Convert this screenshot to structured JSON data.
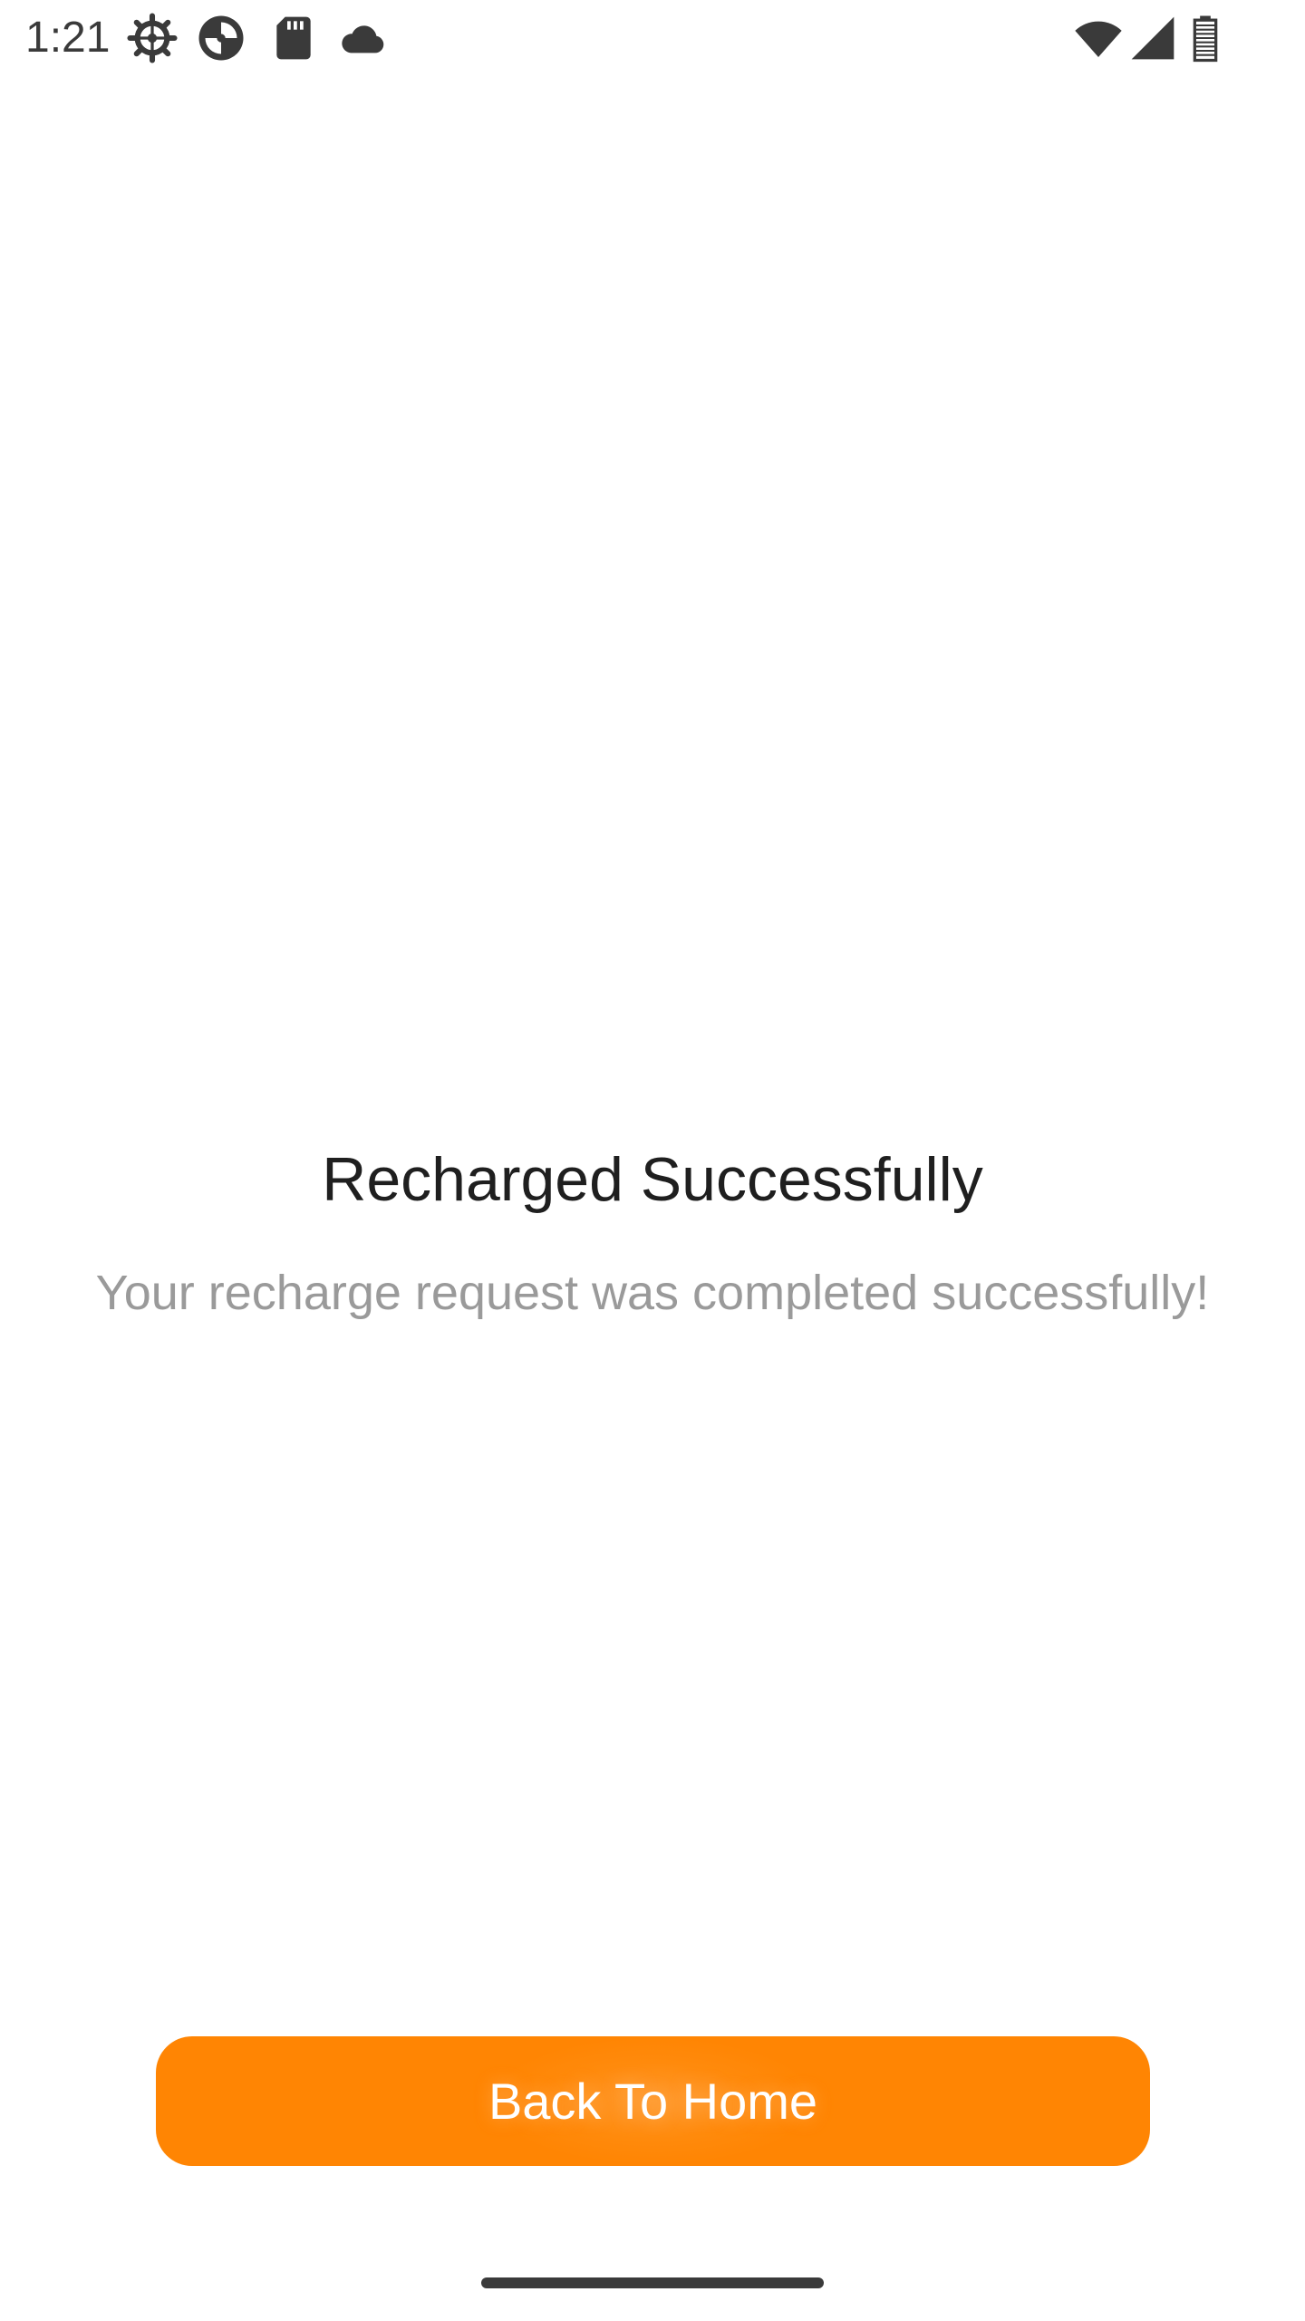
{
  "status_bar": {
    "time": "1:21",
    "icons_left": [
      "settings-gear-icon",
      "app-swirl-icon",
      "sd-card-icon",
      "cloud-icon"
    ],
    "icons_right": [
      "wifi-icon",
      "cell-signal-icon",
      "battery-icon"
    ]
  },
  "main": {
    "title": "Recharged Successfully",
    "message": "Your recharge request was completed successfully!"
  },
  "actions": {
    "home_button_label": "Back To Home"
  },
  "colors": {
    "accent": "#FF8503",
    "title_text": "#1F1F1F",
    "message_text": "#9A9A9A",
    "background": "#FFFFFF"
  }
}
